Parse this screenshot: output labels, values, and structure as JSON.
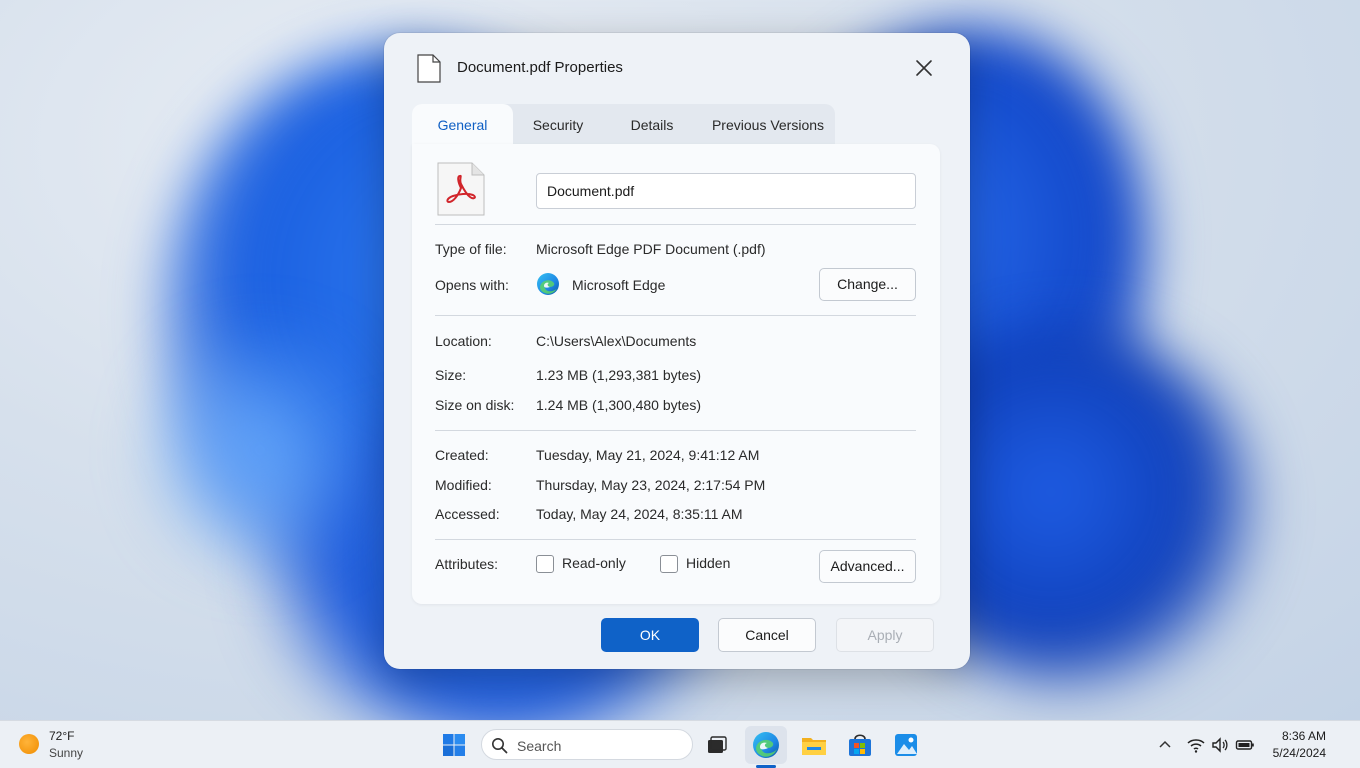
{
  "dialog": {
    "title": "Document.pdf Properties",
    "tabs": [
      {
        "label": "General",
        "active": true
      },
      {
        "label": "Security",
        "active": false
      },
      {
        "label": "Details",
        "active": false
      },
      {
        "label": "Previous Versions",
        "active": false
      }
    ],
    "file_name": "Document.pdf",
    "type_of_file": {
      "label": "Type of file:",
      "value": "Microsoft Edge PDF Document (.pdf)"
    },
    "opens_with": {
      "label": "Opens with:",
      "value": "Microsoft Edge",
      "button": "Change..."
    },
    "location": {
      "label": "Location:",
      "value": "C:\\Users\\Alex\\Documents"
    },
    "size": {
      "label": "Size:",
      "value": "1.23 MB (1,293,381 bytes)"
    },
    "size_on_disk": {
      "label": "Size on disk:",
      "value": "1.24 MB (1,300,480 bytes)"
    },
    "created": {
      "label": "Created:",
      "value": "Tuesday, May 21, 2024, 9:41:12 AM"
    },
    "modified": {
      "label": "Modified:",
      "value": "Thursday, May 23, 2024, 2:17:54 PM"
    },
    "accessed": {
      "label": "Accessed:",
      "value": "Today, May 24, 2024, 8:35:11 AM"
    },
    "attributes": {
      "label": "Attributes:",
      "read_only": "Read-only",
      "hidden": "Hidden",
      "button": "Advanced..."
    },
    "buttons": {
      "ok": "OK",
      "cancel": "Cancel",
      "apply": "Apply"
    }
  },
  "taskbar": {
    "weather": {
      "temp": "72°F",
      "condition": "Sunny"
    },
    "search_placeholder": "Search",
    "clock": {
      "time": "8:36 AM",
      "date": "5/24/2024"
    }
  },
  "colors": {
    "accent": "#0f62c8",
    "active_tab_text": "#0f5fc4"
  }
}
